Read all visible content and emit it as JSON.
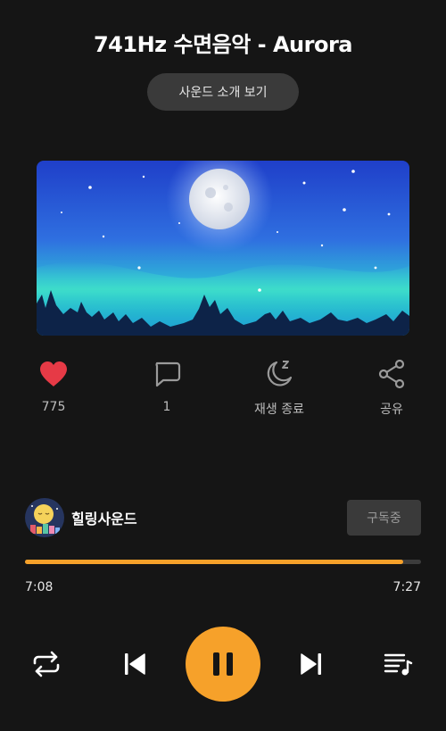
{
  "title": "741Hz 수면음악 - Aurora",
  "intro_button": "사운드 소개 보기",
  "actions": [
    {
      "icon": "heart-icon",
      "label": "775"
    },
    {
      "icon": "comment-icon",
      "label": "1"
    },
    {
      "icon": "sleep-timer-icon",
      "label": "재생 종료"
    },
    {
      "icon": "share-icon",
      "label": "공유"
    }
  ],
  "channel": {
    "name": "힐링사운드",
    "subscribe_label": "구독중"
  },
  "player": {
    "current_time": "7:08",
    "total_time": "7:27",
    "progress_fraction": 0.955
  },
  "colors": {
    "accent": "#f6a12a",
    "heart": "#e63a46",
    "background": "#151515"
  }
}
